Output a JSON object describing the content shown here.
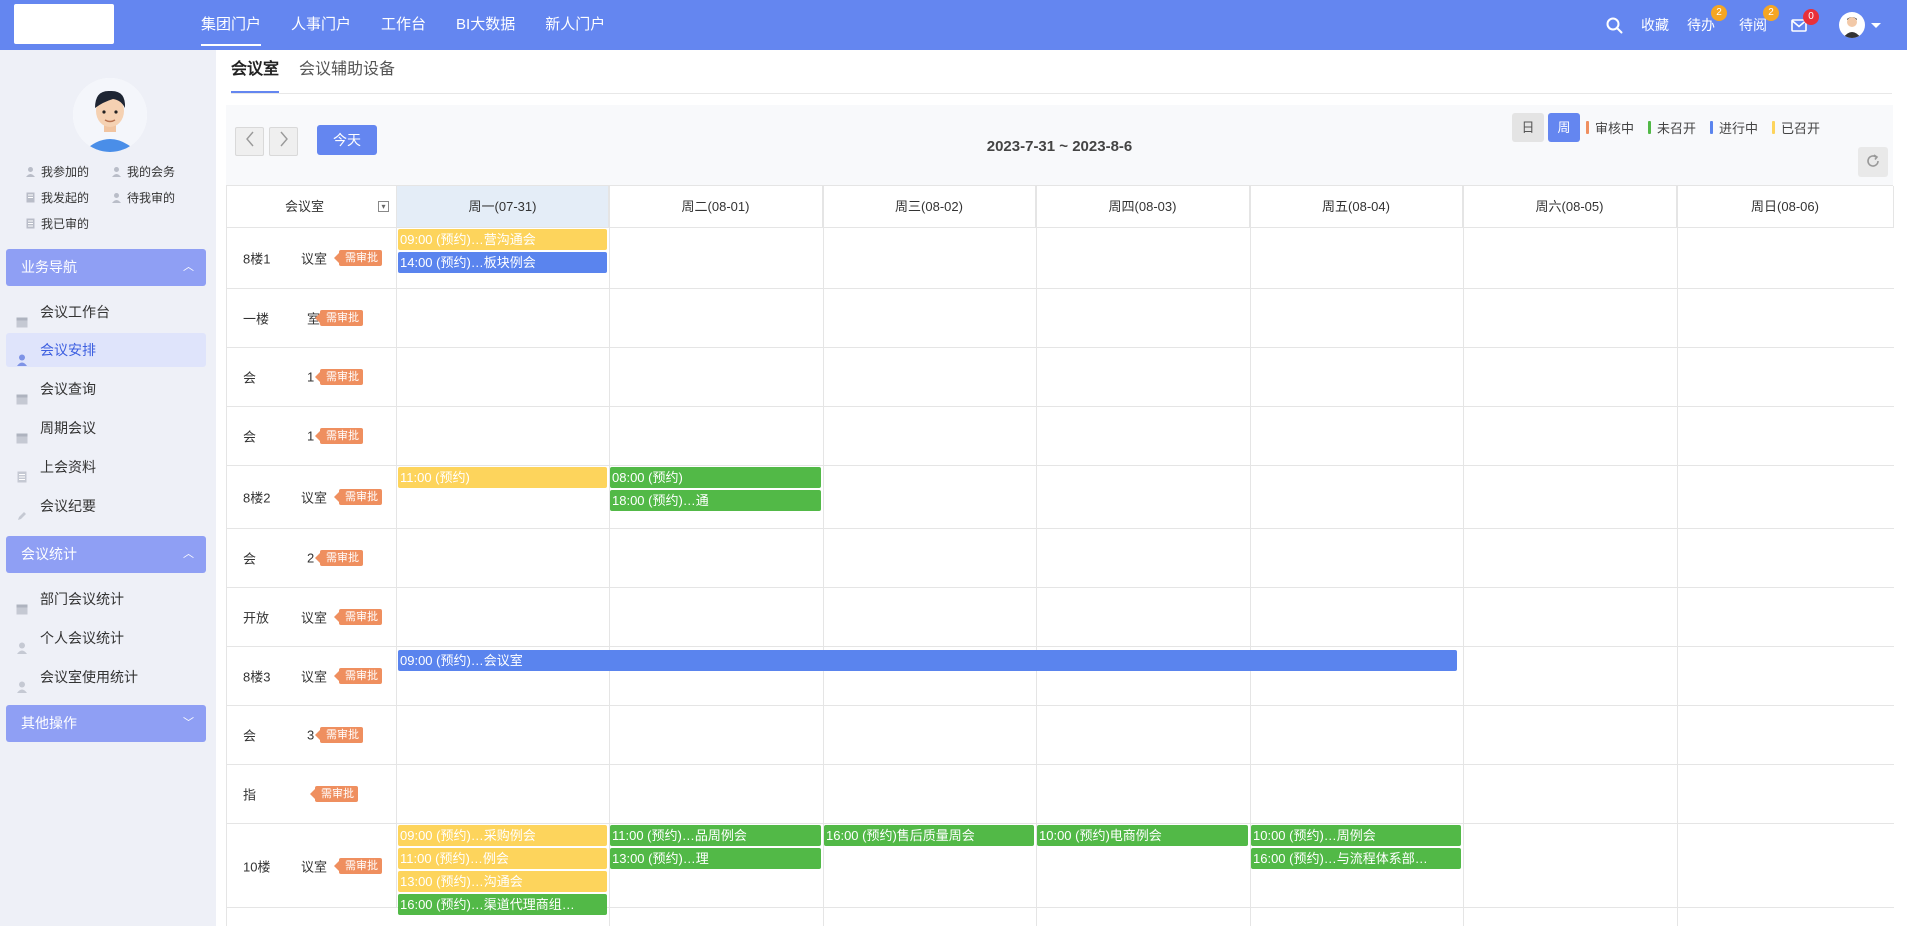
{
  "topbar": {
    "nav": [
      "集团门户",
      "人事门户",
      "工作台",
      "BI大数据",
      "新人门户"
    ],
    "favorites": "收藏",
    "todo": {
      "label": "待办",
      "count": "2"
    },
    "toread": {
      "label": "待阅",
      "count": "2"
    },
    "mail_count": "0"
  },
  "sidebar": {
    "quick_links": [
      "我参加的",
      "我的会务",
      "我发起的",
      "待我审的",
      "我已审的"
    ],
    "groups": [
      {
        "title": "业务导航",
        "items": [
          "会议工作台",
          "会议安排",
          "会议查询",
          "周期会议",
          "上会资料",
          "会议纪要"
        ]
      },
      {
        "title": "会议统计",
        "items": [
          "部门会议统计",
          "个人会议统计",
          "会议室使用统计"
        ]
      },
      {
        "title": "其他操作",
        "items": []
      }
    ]
  },
  "tabs": [
    "会议室",
    "会议辅助设备"
  ],
  "toolbar": {
    "today": "今天",
    "date_range": "2023-7-31 ~ 2023-8-6",
    "view_day": "日",
    "view_week": "周",
    "legend": [
      {
        "label": "审核中",
        "color": "#ef8f5f"
      },
      {
        "label": "未召开",
        "color": "#52b947"
      },
      {
        "label": "进行中",
        "color": "#5a84ee"
      },
      {
        "label": "已召开",
        "color": "#fdd45c"
      }
    ]
  },
  "grid": {
    "room_header": "会议室",
    "days": [
      "周一(07-31)",
      "周二(08-01)",
      "周三(08-02)",
      "周四(08-03)",
      "周五(08-04)",
      "周六(08-05)",
      "周日(08-06)"
    ],
    "approval_tag": "需审批",
    "rows": [
      {
        "name": "8楼1",
        "suffix": "议室"
      },
      {
        "name": "一楼",
        "suffix": "室"
      },
      {
        "name": "会",
        "suffix": "1"
      },
      {
        "name": "会",
        "suffix": "1"
      },
      {
        "name": "8楼2",
        "suffix": "议室"
      },
      {
        "name": "会",
        "suffix": "2"
      },
      {
        "name": "开放",
        "suffix": "议室"
      },
      {
        "name": "8楼3",
        "suffix": "议室"
      },
      {
        "name": "会",
        "suffix": "3"
      },
      {
        "name": "指",
        "suffix": ""
      },
      {
        "name": "10楼",
        "suffix": "议室"
      }
    ],
    "events": [
      {
        "row": 0,
        "day": 0,
        "slot": 0,
        "text": "09:00 (预约)…营沟通会",
        "color": "yellow"
      },
      {
        "row": 0,
        "day": 0,
        "slot": 1,
        "text": "14:00 (预约)…板块例会",
        "color": "blue"
      },
      {
        "row": 4,
        "day": 0,
        "slot": 0,
        "text": "11:00 (预约)",
        "color": "yellow"
      },
      {
        "row": 4,
        "day": 1,
        "slot": 0,
        "text": "08:00 (预约)",
        "color": "green"
      },
      {
        "row": 4,
        "day": 1,
        "slot": 1,
        "text": "18:00 (预约)…通",
        "color": "green"
      },
      {
        "row": 10,
        "day": 0,
        "slot": 0,
        "text": "09:00 (预约)…采购例会",
        "color": "yellow"
      },
      {
        "row": 10,
        "day": 0,
        "slot": 1,
        "text": "11:00 (预约)…例会",
        "color": "yellow"
      },
      {
        "row": 10,
        "day": 0,
        "slot": 2,
        "text": "13:00 (预约)…沟通会",
        "color": "yellow"
      },
      {
        "row": 10,
        "day": 0,
        "slot": 3,
        "text": "16:00 (预约)…渠道代理商组…",
        "color": "green"
      },
      {
        "row": 10,
        "day": 1,
        "slot": 0,
        "text": "11:00 (预约)…品周例会",
        "color": "green"
      },
      {
        "row": 10,
        "day": 1,
        "slot": 1,
        "text": "13:00 (预约)…理",
        "color": "green"
      },
      {
        "row": 10,
        "day": 2,
        "slot": 0,
        "text": "16:00 (预约)售后质量周会",
        "color": "green"
      },
      {
        "row": 10,
        "day": 3,
        "slot": 0,
        "text": "10:00 (预约)电商例会",
        "color": "green"
      },
      {
        "row": 10,
        "day": 4,
        "slot": 0,
        "text": "10:00 (预约)…周例会",
        "color": "green"
      },
      {
        "row": 10,
        "day": 4,
        "slot": 1,
        "text": "16:00 (预约)…与流程体系部…",
        "color": "green"
      }
    ],
    "span_event": {
      "row": 7,
      "text": "09:00 (预约)…会议室",
      "color": "blue",
      "day_start": 0,
      "day_end": 4
    }
  }
}
